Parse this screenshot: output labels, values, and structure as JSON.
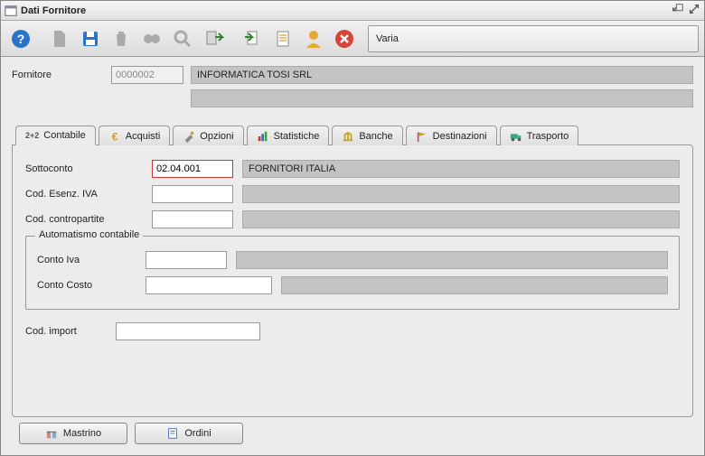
{
  "window": {
    "title": "Dati Fornitore"
  },
  "toolbar": {
    "varia": "Varia"
  },
  "supplier": {
    "label": "Fornitore",
    "code": "0000002",
    "name": "INFORMATICA TOSI SRL",
    "line2": ""
  },
  "tabs": {
    "contabile": "Contabile",
    "acquisti": "Acquisti",
    "opzioni": "Opzioni",
    "statistiche": "Statistiche",
    "banche": "Banche",
    "destinazioni": "Destinazioni",
    "trasporto": "Trasporto"
  },
  "contabile": {
    "sottoconto_label": "Sottoconto",
    "sottoconto_value": "02.04.001",
    "sottoconto_desc": "FORNITORI ITALIA",
    "esenz_label": "Cod. Esenz. IVA",
    "esenz_value": "",
    "esenz_desc": "",
    "contropartite_label": "Cod. contropartite",
    "contropartite_value": "",
    "contropartite_desc": "",
    "automatismo_legend": "Automatismo contabile",
    "conto_iva_label": "Conto Iva",
    "conto_iva_value": "",
    "conto_iva_desc": "",
    "conto_costo_label": "Conto Costo",
    "conto_costo_value": "",
    "conto_costo_desc": "",
    "cod_import_label": "Cod. import",
    "cod_import_value": ""
  },
  "footer": {
    "mastrino": "Mastrino",
    "ordini": "Ordini"
  }
}
